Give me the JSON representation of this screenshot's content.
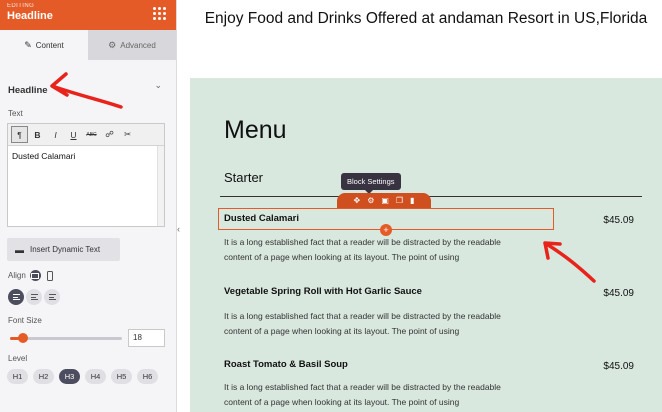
{
  "sidebar": {
    "editing_label": "EDITING",
    "title": "Headline",
    "tabs": [
      {
        "label": "Content",
        "icon": "pencil-icon"
      },
      {
        "label": "Advanced",
        "icon": "sliders-icon"
      }
    ],
    "section_title": "Headline",
    "text_label": "Text",
    "toolbar_icons": [
      "format-icon",
      "bold-icon",
      "italic-icon",
      "underline-icon",
      "strikethrough-icon",
      "link-icon",
      "unlink-icon"
    ],
    "toolbar_glyphs": [
      "¶",
      "B",
      "I",
      "U",
      "ABC",
      "☍",
      "✂"
    ],
    "editor_value": "Dusted Calamari",
    "insert_dynamic_text": "Insert Dynamic Text",
    "align_label": "Align",
    "font_size_label": "Font Size",
    "font_size_value": "18",
    "font_size_fraction": 0.12,
    "level_label": "Level",
    "levels": [
      "H1",
      "H2",
      "H3",
      "H4",
      "H5",
      "H6"
    ],
    "active_level": "H3"
  },
  "page": {
    "heading": "Enjoy Food and Drinks Offered at andaman Resort in US,Florida",
    "menu_title": "Menu",
    "section": "Starter",
    "block_settings_tooltip": "Block Settings",
    "items": [
      {
        "name": "Dusted Calamari",
        "price": "$45.09",
        "desc": "It is a long established fact that a reader will be distracted by the readable content of a page when looking at its layout. The point of using"
      },
      {
        "name": "Vegetable Spring Roll with Hot Garlic Sauce",
        "price": "$45.09",
        "desc": "It is a long established fact that a reader will be distracted by the readable content of a page when looking at its layout. The point of using"
      },
      {
        "name": "Roast Tomato & Basil Soup",
        "price": "$45.09",
        "desc": "It is a long established fact that a reader will be distracted by the readable content of a page when looking at its layout. The point of using"
      }
    ]
  },
  "colors": {
    "accent": "#e45b27",
    "menu_bg": "#d9e8de",
    "annotation": "#e8231c"
  }
}
